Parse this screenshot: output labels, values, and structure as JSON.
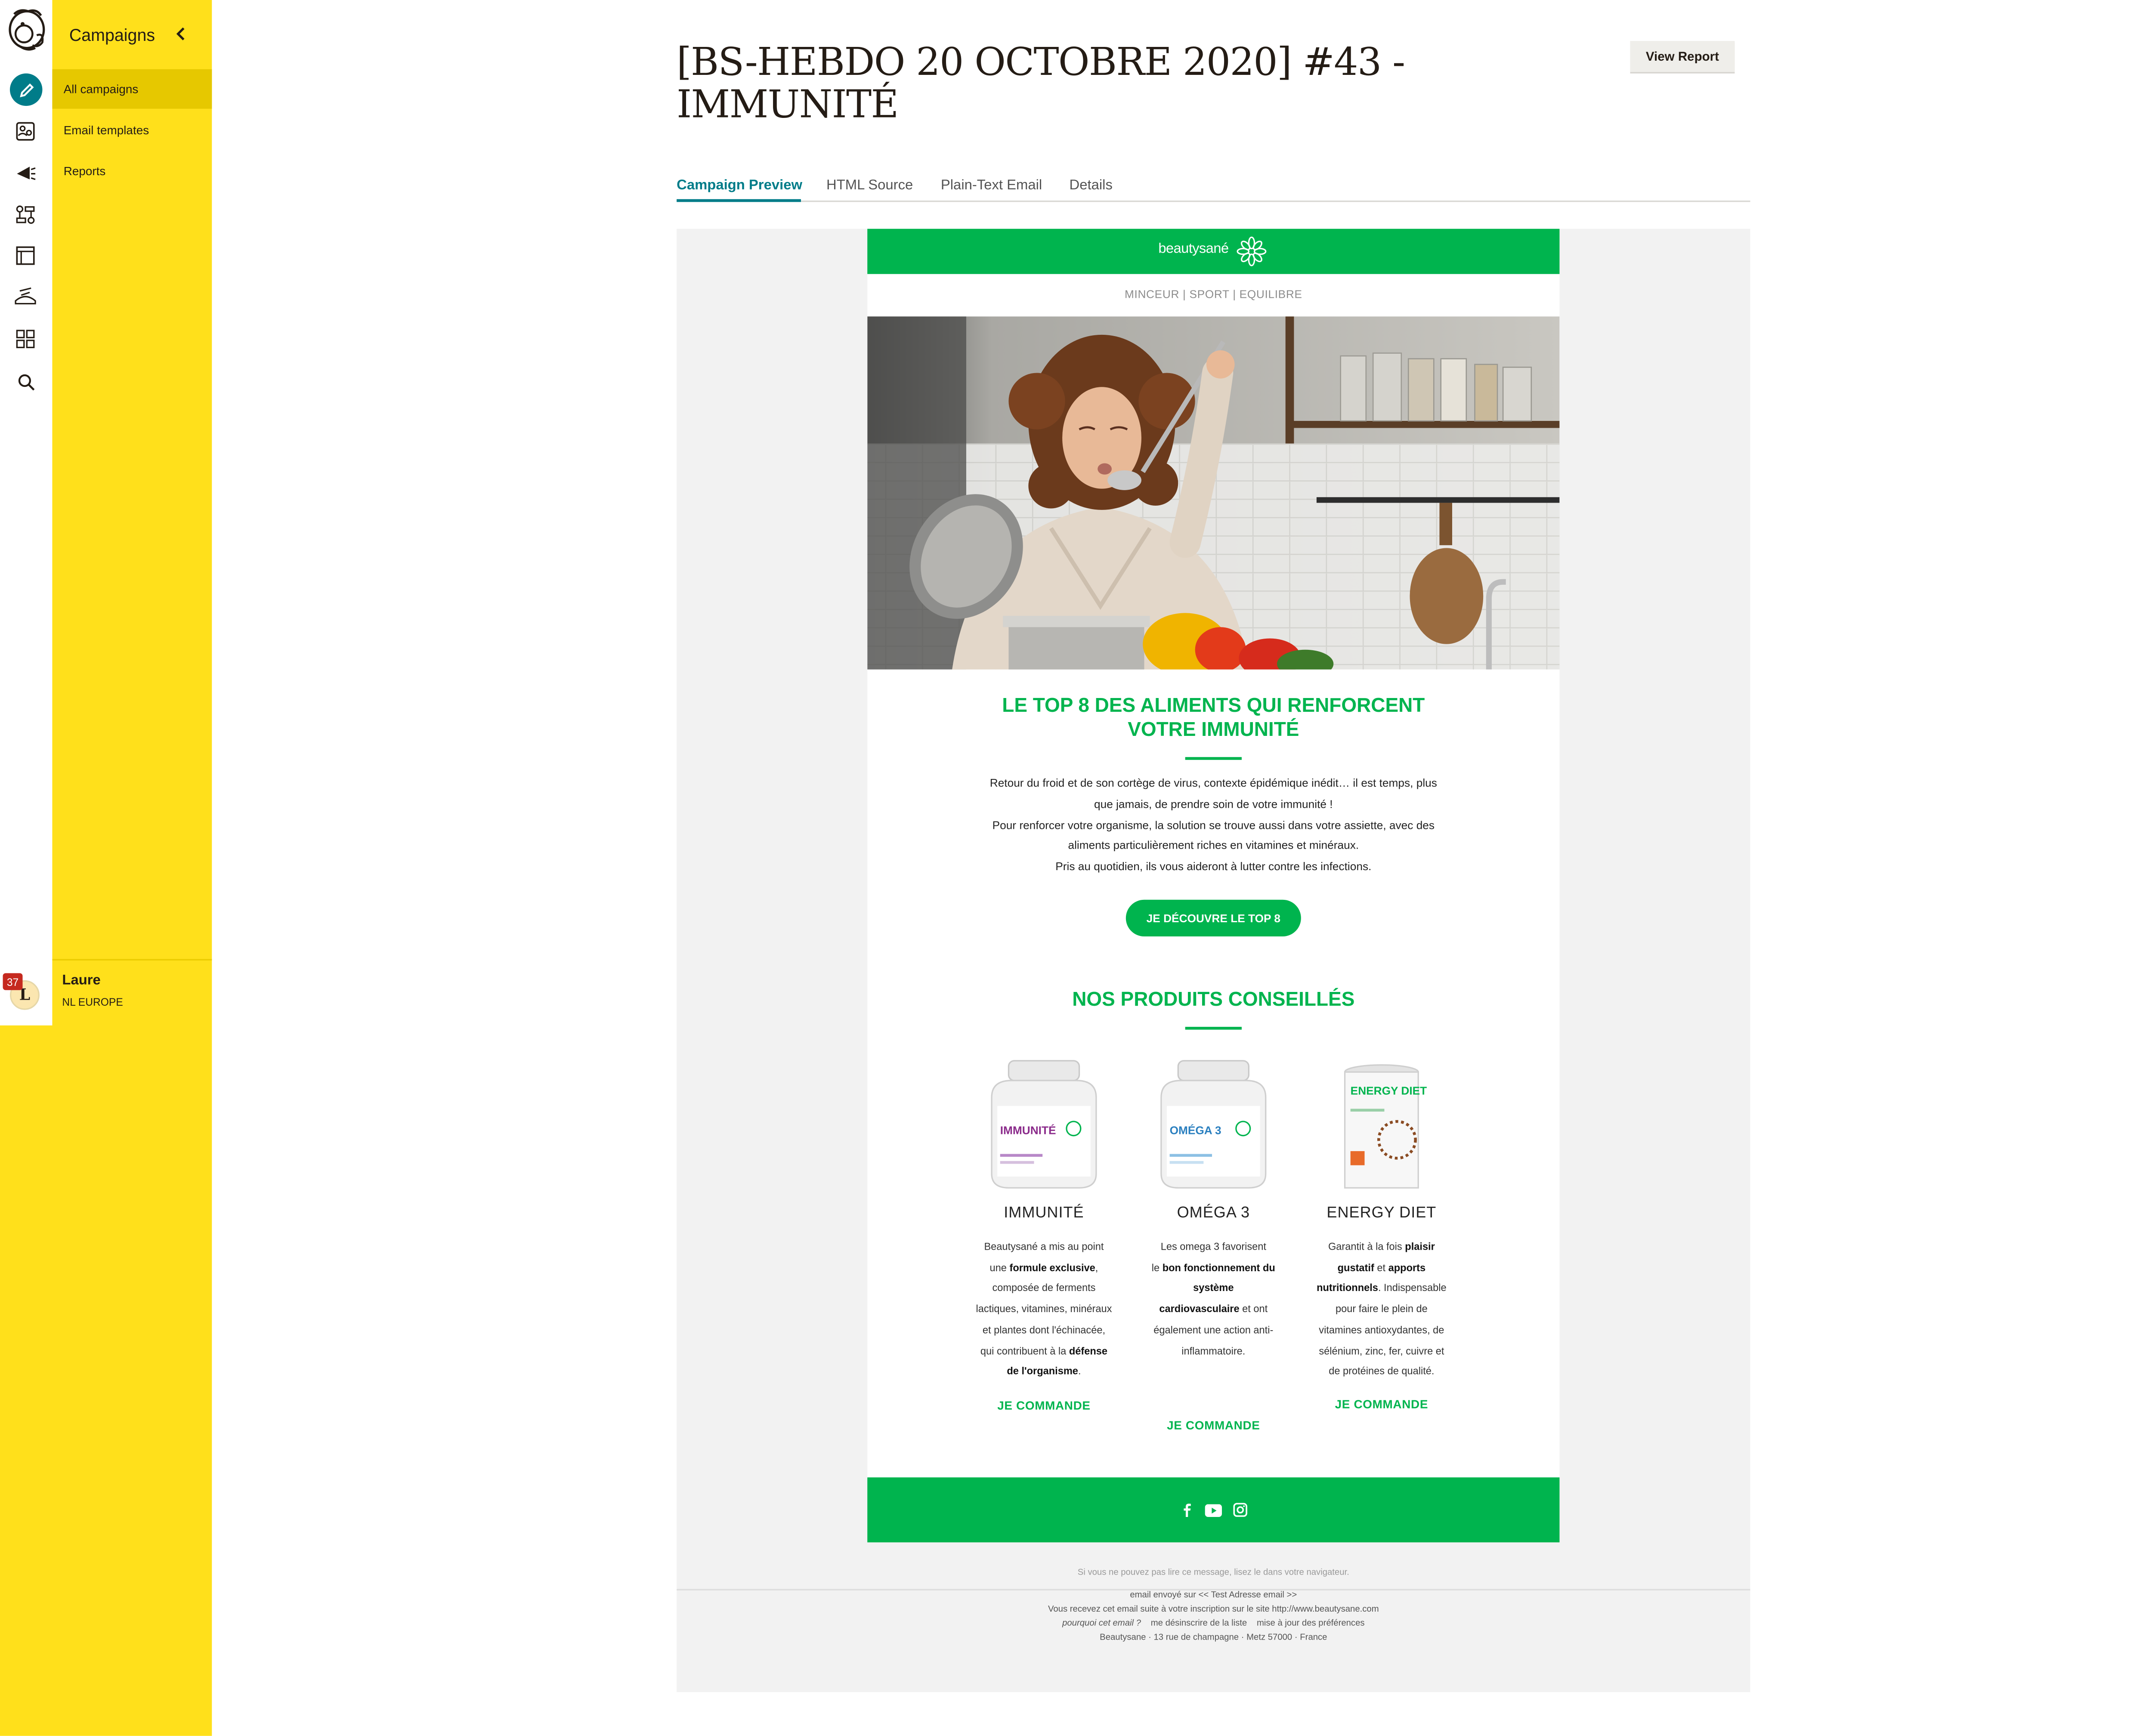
{
  "sidebar": {
    "section_title": "Campaigns",
    "items": [
      {
        "label": "All campaigns",
        "active": true
      },
      {
        "label": "Email templates",
        "active": false
      },
      {
        "label": "Reports",
        "active": false
      }
    ],
    "rail_icons": [
      "create-pencil-icon",
      "audience-icon",
      "campaigns-megaphone-icon",
      "automations-icon",
      "website-icon",
      "integrations-icon",
      "content-grid-icon",
      "search-icon"
    ]
  },
  "user": {
    "name": "Laure",
    "org": "NL EUROPE",
    "initial": "L",
    "notifications": "37"
  },
  "header": {
    "title": "[BS-HEBDO 20 OCTOBRE 2020] #43 - IMMUNITÉ",
    "view_report": "View Report"
  },
  "tabs": [
    {
      "label": "Campaign Preview",
      "active": true
    },
    {
      "label": "HTML Source",
      "active": false
    },
    {
      "label": "Plain-Text Email",
      "active": false
    },
    {
      "label": "Details",
      "active": false
    }
  ],
  "email": {
    "brand": "beautysané",
    "nav": "MINCEUR  |  SPORT  |  EQUILIBRE",
    "headline_line1": "LE TOP 8 DES ALIMENTS QUI RENFORCENT",
    "headline_line2": "VOTRE IMMUNITÉ",
    "body": [
      "Retour du froid et de son cortège de virus, contexte épidémique inédit… il est temps, plus",
      "que jamais, de prendre soin de votre immunité !",
      "Pour renforcer votre organisme, la solution se trouve aussi dans votre assiette, avec des",
      "aliments particulièrement riches en vitamines et minéraux.",
      "Pris au quotidien, ils vous aideront à lutter contre les infections."
    ],
    "cta": "JE DÉCOUVRE LE TOP 8",
    "products_title": "NOS PRODUITS CONSEILLÉS",
    "products": [
      {
        "name": "IMMUNITÉ",
        "jar_label": "IMMUNITÉ",
        "desc": [
          "Beautysané a mis au point",
          "une ",
          "formule exclusive",
          ",",
          "composée de ferments",
          "lactiques, vitamines, minéraux",
          "et plantes dont l'échinacée,",
          "qui contribuent à la ",
          "défense",
          "de l'organisme",
          "."
        ],
        "cta": "JE COMMANDE"
      },
      {
        "name": "OMÉGA 3",
        "jar_label": "OMÉGA 3",
        "desc": [
          "Les omega 3 favorisent",
          "le ",
          "bon fonctionnement du",
          "système",
          "cardiovasculaire",
          " et ont",
          "également une action anti-",
          "inflammatoire."
        ],
        "cta": "JE COMMANDE"
      },
      {
        "name": "ENERGY DIET",
        "jar_label": "ENERGY DIET",
        "desc": [
          "Garantit à la fois ",
          "plaisir",
          "gustatif",
          " et ",
          "apports",
          "nutritionnels",
          ". Indispensable",
          "pour faire le plein de",
          "vitamines antioxydantes, de",
          "sélénium, zinc, fer, cuivre et",
          "de protéines de qualité."
        ],
        "cta": "JE COMMANDE"
      }
    ],
    "footer": {
      "view_in_browser": "Si vous ne pouvez pas lire ce message, lisez le dans votre navigateur.",
      "sent_to": "email envoyé sur << Test Adresse email >>",
      "reason": "Vous recevez cet email suite à votre inscription sur le site http://www.beautysane.com",
      "link_why": "pourquoi cet email ?",
      "link_unsub": "me désinscrire de la liste",
      "link_prefs": "mise à jour des préférences",
      "address": "Beautysane · 13 rue de champagne · Metz 57000 · France"
    }
  },
  "help_label": "?",
  "colors": {
    "accent": "#007c89",
    "sidebar": "#ffe01b",
    "brand_green": "#00b44e"
  }
}
